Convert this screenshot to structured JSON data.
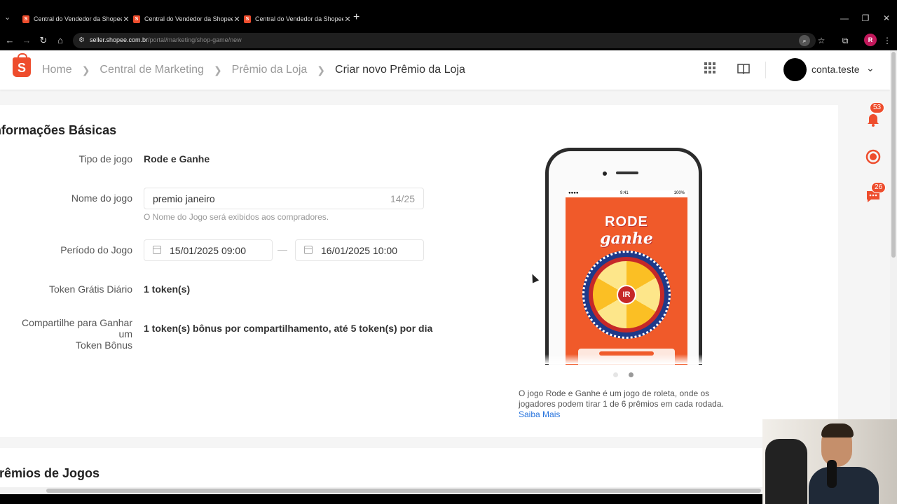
{
  "browser": {
    "tabs": [
      {
        "title": "Central do Vendedor da Shopee",
        "favicon": "S"
      },
      {
        "title": "Central do Vendedor da Shopee",
        "favicon": "S"
      },
      {
        "title": "Central do Vendedor da Shopee",
        "favicon": "S"
      }
    ],
    "url_host": "seller.shopee.com.br",
    "url_path": "/portal/marketing/shop-game/new",
    "profile_initial": "R"
  },
  "header": {
    "breadcrumbs": [
      {
        "label": "Home"
      },
      {
        "label": "Central de Marketing"
      },
      {
        "label": "Prêmio da Loja"
      }
    ],
    "current": "Criar novo Prêmio da Loja",
    "account": "conta.teste"
  },
  "side_badges": {
    "notifications": "53",
    "chat": "26"
  },
  "basic_info": {
    "title": "Informações Básicas",
    "game_type_label": "Tipo de jogo",
    "game_type_value": "Rode e Ganhe",
    "game_name_label": "Nome do jogo",
    "game_name_value": "premio janeiro",
    "game_name_counter": "14/25",
    "game_name_hint": "O Nome do Jogo será exibidos aos compradores.",
    "period_label": "Período do Jogo",
    "period_start": "15/01/2025 09:00",
    "period_separator": "—",
    "period_end": "16/01/2025 10:00",
    "token_label": "Token Grátis Diário",
    "token_value": "1 token(s)",
    "share_label_1": "Compartilhe para Ganhar um",
    "share_label_2": "Token Bônus",
    "share_value": "1 token(s) bônus por compartilhamento, até 5 token(s) por dia"
  },
  "preview": {
    "title_line1": "RODE",
    "title_line2": "ganhe",
    "wheel_center": "IR",
    "status_time": "9:41",
    "status_battery": "100%",
    "description": "O jogo Rode e Ganhe é um jogo de roleta, onde os jogadores podem tirar 1 de 6 prêmios em cada rodada.",
    "learn_more": "Saiba Mais",
    "carousel_active": 2,
    "carousel_total": 2
  },
  "prizes": {
    "title": "Prêmios de Jogos"
  },
  "colors": {
    "brand": "#ee4d2d",
    "link": "#2673dd"
  }
}
